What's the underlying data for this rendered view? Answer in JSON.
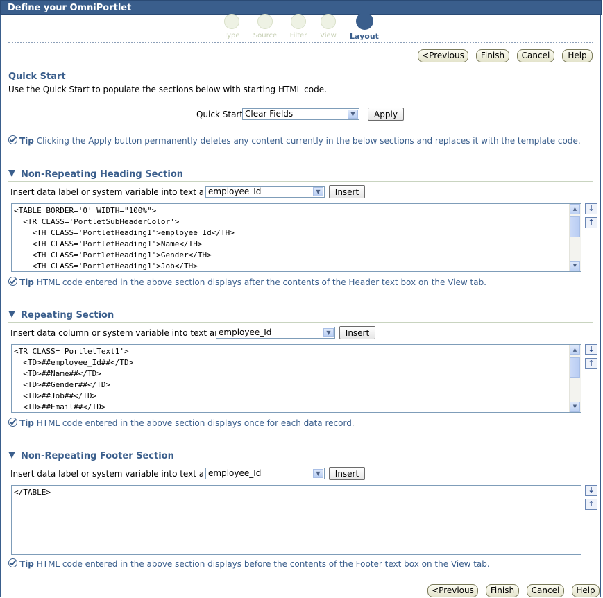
{
  "window": {
    "title": "Define your OmniPortlet"
  },
  "train": {
    "steps": [
      "Type",
      "Source",
      "Filter",
      "View",
      "Layout"
    ],
    "active": "Layout"
  },
  "nav": {
    "previous": "<Previous",
    "finish": "Finish",
    "cancel": "Cancel",
    "help": "Help"
  },
  "quick_start": {
    "heading": "Quick Start",
    "description": "Use the Quick Start to populate the sections below with starting HTML code.",
    "label": "Quick Start",
    "selected": "Clear Fields",
    "apply": "Apply",
    "tip_label": "Tip",
    "tip_text": "Clicking the Apply button permanently deletes any content currently in the below sections and replaces it with the template code."
  },
  "heading_section": {
    "title": "Non-Repeating Heading Section",
    "insert_label": "Insert data label or system variable into text area:",
    "selected": "employee_Id",
    "insert_button": "Insert",
    "code": "<TABLE BORDER='0' WIDTH=\"100%\">\n  <TR CLASS='PortletSubHeaderColor'>\n    <TH CLASS='PortletHeading1'>employee_Id</TH>\n    <TH CLASS='PortletHeading1'>Name</TH>\n    <TH CLASS='PortletHeading1'>Gender</TH>\n    <TH CLASS='PortletHeading1'>Job</TH>",
    "tip_label": "Tip",
    "tip_text": "HTML code entered in the above section displays after the contents of the Header text box on the View tab."
  },
  "repeating_section": {
    "title": "Repeating Section",
    "insert_label": "Insert data column or system variable into text area:",
    "selected": "employee_Id",
    "insert_button": "Insert",
    "code": "<TR CLASS='PortletText1'>\n  <TD>##employee_Id##</TD>\n  <TD>##Name##</TD>\n  <TD>##Gender##</TD>\n  <TD>##Job##</TD>\n  <TD>##Email##</TD>",
    "tip_label": "Tip",
    "tip_text": "HTML code entered in the above section displays once for each data record."
  },
  "footer_section": {
    "title": "Non-Repeating Footer Section",
    "insert_label": "Insert data label or system variable into text area:",
    "selected": "employee_Id",
    "insert_button": "Insert",
    "code": "</TABLE>",
    "tip_label": "Tip",
    "tip_text": "HTML code entered in the above section displays before the contents of the Footer text box on the View tab."
  },
  "colors": {
    "title_bar": "#3a5e8c",
    "section_heading": "#3a5e8c",
    "tip_text": "#3a5e8c"
  },
  "icons": {
    "section_toggle": "triangle-down-icon",
    "tip": "checkmark-circle-icon",
    "move_down": "arrow-down-icon",
    "move_up": "arrow-up-icon"
  }
}
